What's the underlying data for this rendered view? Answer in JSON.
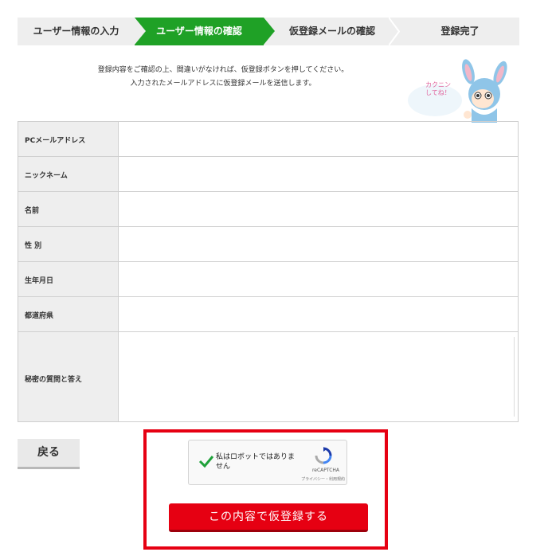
{
  "steps": {
    "step1": "ユーザー情報の入力",
    "step2": "ユーザー情報の確認",
    "step3": "仮登録メールの確認",
    "step4": "登録完了"
  },
  "intro": {
    "line1": "登録内容をご確認の上、間違いがなければ、仮登録ボタンを押してください。",
    "line2": "入力されたメールアドレスに仮登録メールを送信します。"
  },
  "mascot": {
    "speech": "カクニン してね！"
  },
  "form": {
    "rows": [
      {
        "label": "PCメールアドレス",
        "value": ""
      },
      {
        "label": "ニックネーム",
        "value": ""
      },
      {
        "label": "名前",
        "value": ""
      },
      {
        "label": "性 別",
        "value": ""
      },
      {
        "label": "生年月日",
        "value": ""
      },
      {
        "label": "都道府県",
        "value": ""
      },
      {
        "label": "秘密の質問と答え",
        "value": ""
      }
    ]
  },
  "actions": {
    "back_label": "戻る",
    "submit_label": "この内容で仮登録する"
  },
  "captcha": {
    "text": "私はロボットではありません",
    "brand": "reCAPTCHA",
    "links": "プライバシー・利用規約"
  },
  "colors": {
    "active_step": "#1fa126",
    "highlight": "#e60012",
    "submit": "#e60012"
  }
}
